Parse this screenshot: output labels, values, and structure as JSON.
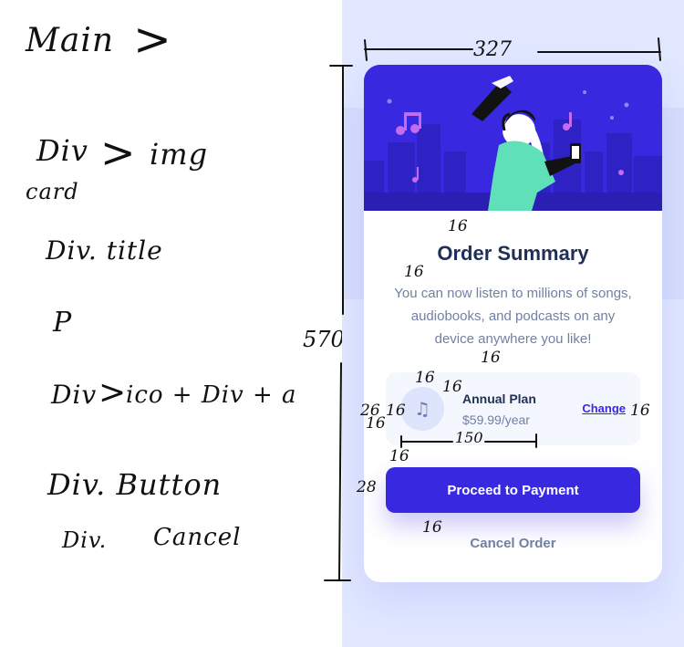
{
  "sketch": {
    "notes": [
      "Main",
      "Div",
      "img",
      "card",
      "Div. title",
      "P",
      "Div",
      "ico + Div + a",
      "Div. Button",
      "Div.",
      "Cancel"
    ],
    "dimensions": {
      "width": "327",
      "height": "570",
      "spacings": [
        "16",
        "16",
        "16",
        "16",
        "16",
        "16",
        "26",
        "16",
        "16",
        "28",
        "16",
        "150",
        "16"
      ]
    }
  },
  "card": {
    "title": "Order Summary",
    "description": "You can now listen to millions of songs, audiobooks, and podcasts on any device anywhere you like!",
    "plan": {
      "icon": "music-note-icon",
      "name": "Annual Plan",
      "price": "$59.99/year",
      "change_label": "Change"
    },
    "primary_button_label": "Proceed to Payment",
    "cancel_label": "Cancel Order"
  },
  "colors": {
    "background": "#e0e7ff",
    "primary": "#3829e0",
    "title": "#1f2f56",
    "muted": "#7180a3",
    "plan_bg": "#f5f7ff"
  }
}
